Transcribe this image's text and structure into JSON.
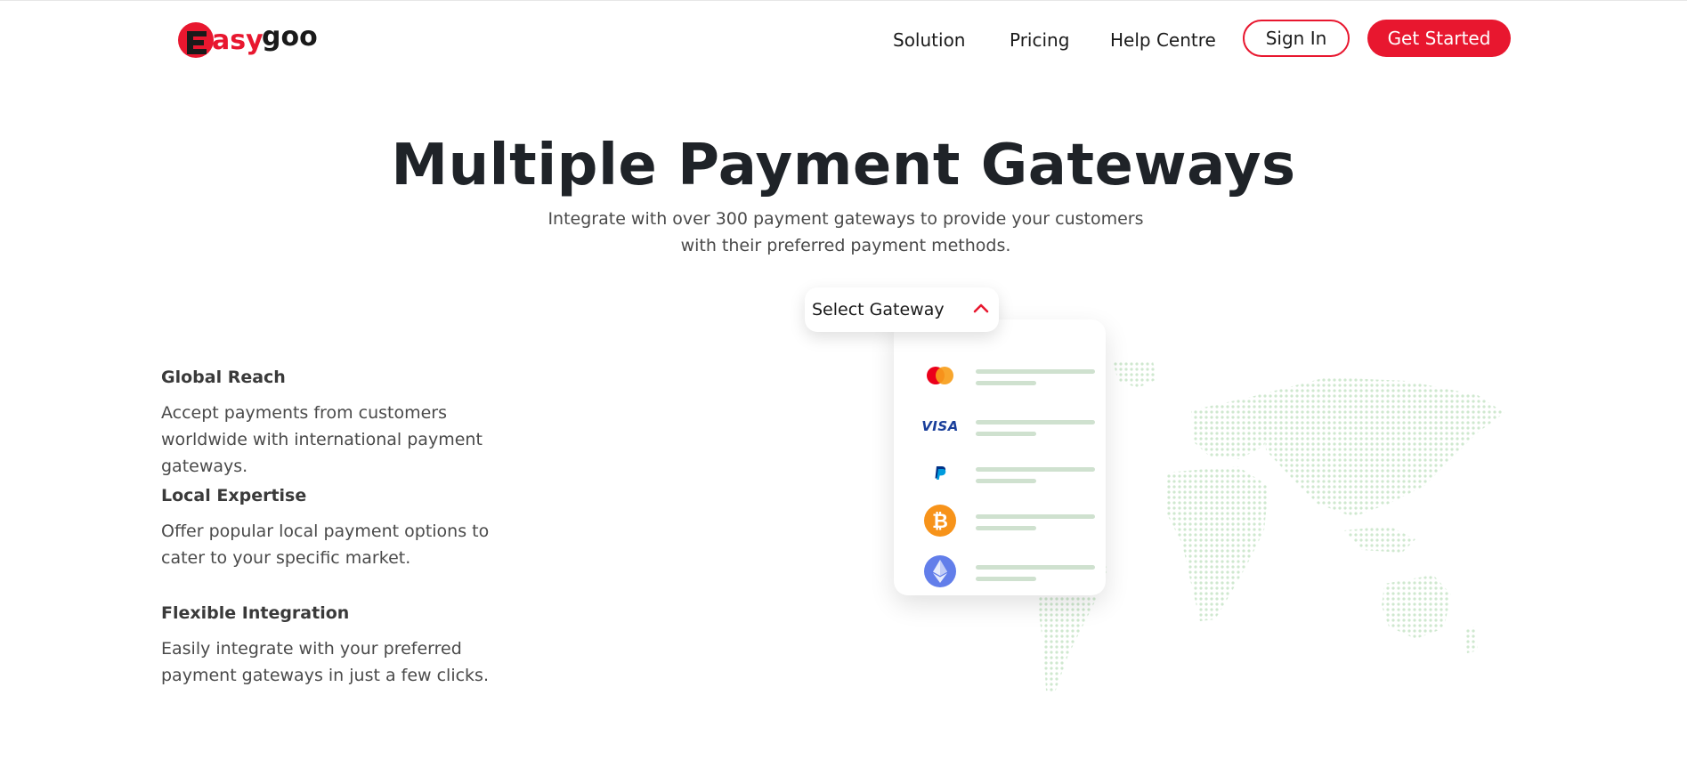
{
  "header": {
    "logo_alt": "easygoo",
    "nav": {
      "solution": "Solution",
      "pricing": "Pricing",
      "help": "Help Centre"
    },
    "sign_in": "Sign In",
    "get_started": "Get Started"
  },
  "hero": {
    "title": "Multiple Payment Gateways",
    "subtitle": "Integrate with over 300 payment gateways to provide your customers with their preferred payment methods."
  },
  "features": [
    {
      "title": "Global Reach",
      "text": "Accept payments from customers worldwide with international payment gateways."
    },
    {
      "title": "Local Expertise",
      "text": "Offer popular local payment options to cater to your specific market."
    },
    {
      "title": "Flexible Integration",
      "text": "Easily integrate with your preferred payment gateways in just a few clicks."
    }
  ],
  "gateway": {
    "select_label": "Select Gateway",
    "items": [
      {
        "icon": "mastercard-icon"
      },
      {
        "icon": "visa-icon",
        "label": "VISA"
      },
      {
        "icon": "paypal-icon"
      },
      {
        "icon": "bitcoin-icon"
      },
      {
        "icon": "ethereum-icon"
      }
    ]
  },
  "colors": {
    "brand_red": "#e8172f",
    "map_dots": "#cfe8cf",
    "placeholder_line": "#cfe1cf"
  }
}
